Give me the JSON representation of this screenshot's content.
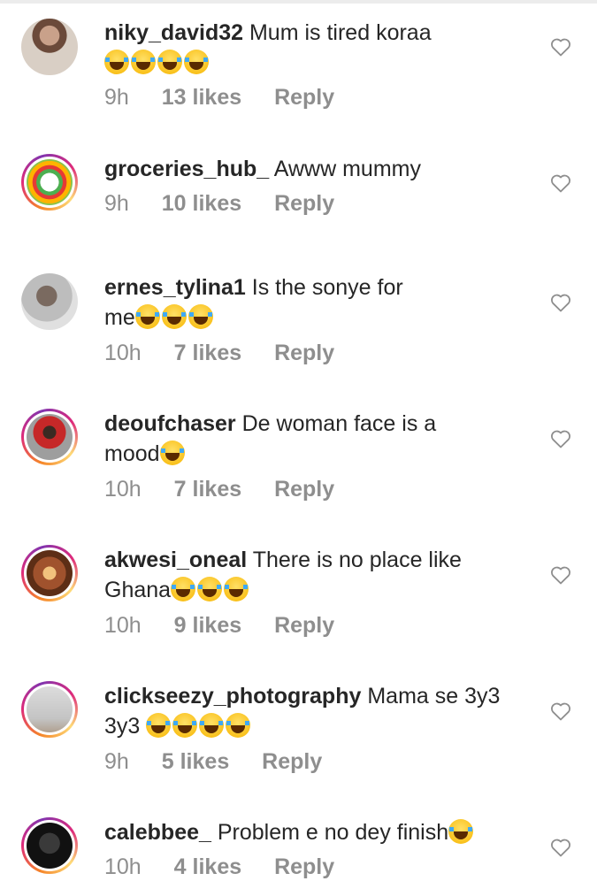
{
  "comments": [
    {
      "username": "niky_david32",
      "text": "Mum is tired koraa",
      "line2": "",
      "emoji_count": 4,
      "emoji_inline": false,
      "time": "9h",
      "likes": "13 likes",
      "reply": "Reply",
      "avatar_style": "plain"
    },
    {
      "username": "groceries_hub_",
      "text": "Awww mummy",
      "line2": "",
      "emoji_count": 0,
      "time": "9h",
      "likes": "10 likes",
      "reply": "Reply",
      "avatar_style": "story"
    },
    {
      "username": "ernes_tylina1",
      "text": "Is the sonye for",
      "line2": "me",
      "emoji_count": 3,
      "time": "10h",
      "likes": "7 likes",
      "reply": "Reply",
      "avatar_style": "plain"
    },
    {
      "username": "deoufchaser",
      "text": "De woman face is a",
      "line2": "mood",
      "emoji_count": 1,
      "time": "10h",
      "likes": "7 likes",
      "reply": "Reply",
      "avatar_style": "story"
    },
    {
      "username": "akwesi_oneal",
      "text": "There is no place like",
      "line2": "Ghana",
      "emoji_count": 3,
      "time": "10h",
      "likes": "9 likes",
      "reply": "Reply",
      "avatar_style": "story"
    },
    {
      "username": "clickseezy_photography",
      "text": "Mama se 3y3",
      "line2": "3y3",
      "emoji_count": 4,
      "time": "9h",
      "likes": "5 likes",
      "reply": "Reply",
      "avatar_style": "story"
    },
    {
      "username": "calebbee_",
      "text": "Problem e no dey finish",
      "line2": "",
      "emoji_count": 1,
      "time": "10h",
      "likes": "4 likes",
      "reply": "Reply",
      "avatar_style": "story"
    }
  ],
  "icons": {
    "like": "heart-outline-icon",
    "emoji": "face-with-tears-of-joy-icon"
  },
  "colors": {
    "username": "#262626",
    "meta": "#8e8e8e",
    "story_ring": "#dd2a7b"
  }
}
